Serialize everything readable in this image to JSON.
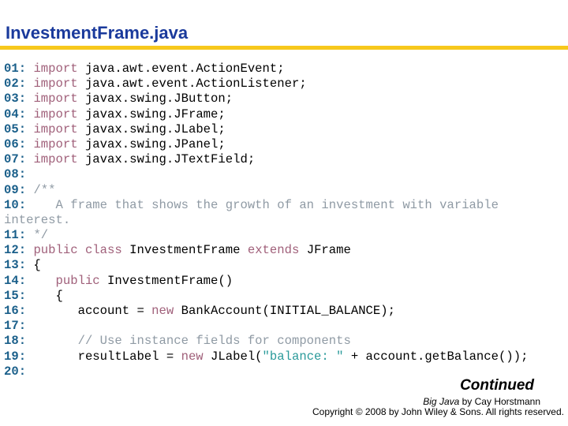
{
  "header": {
    "title": "InvestmentFrame.java",
    "rule_color": "#f7c81c",
    "title_color": "#1a3a9c"
  },
  "code": {
    "colors": {
      "line_number": "#1a5f8a",
      "keyword": "#a0607a",
      "comment": "#8f9aa4",
      "string": "#2a9a9a",
      "text": "#000000"
    },
    "lines": [
      {
        "n": "01:",
        "tokens": [
          {
            "t": " "
          },
          {
            "k": "kw",
            "t": "import"
          },
          {
            "t": " java.awt.event.ActionEvent;"
          }
        ]
      },
      {
        "n": "02:",
        "tokens": [
          {
            "t": " "
          },
          {
            "k": "kw",
            "t": "import"
          },
          {
            "t": " java.awt.event.ActionListener;"
          }
        ]
      },
      {
        "n": "03:",
        "tokens": [
          {
            "t": " "
          },
          {
            "k": "kw",
            "t": "import"
          },
          {
            "t": " javax.swing.JButton;"
          }
        ]
      },
      {
        "n": "04:",
        "tokens": [
          {
            "t": " "
          },
          {
            "k": "kw",
            "t": "import"
          },
          {
            "t": " javax.swing.JFrame;"
          }
        ]
      },
      {
        "n": "05:",
        "tokens": [
          {
            "t": " "
          },
          {
            "k": "kw",
            "t": "import"
          },
          {
            "t": " javax.swing.JLabel;"
          }
        ]
      },
      {
        "n": "06:",
        "tokens": [
          {
            "t": " "
          },
          {
            "k": "kw",
            "t": "import"
          },
          {
            "t": " javax.swing.JPanel;"
          }
        ]
      },
      {
        "n": "07:",
        "tokens": [
          {
            "t": " "
          },
          {
            "k": "kw",
            "t": "import"
          },
          {
            "t": " javax.swing.JTextField;"
          }
        ]
      },
      {
        "n": "08:",
        "tokens": []
      },
      {
        "n": "09:",
        "tokens": [
          {
            "t": " "
          },
          {
            "k": "cm",
            "t": "/**"
          }
        ]
      },
      {
        "n": "10:",
        "tokens": [
          {
            "t": " "
          },
          {
            "k": "cm",
            "t": "   A frame that shows the growth of an investment with variable"
          }
        ]
      },
      {
        "n": "",
        "tokens": [
          {
            "k": "cm",
            "t": "interest."
          }
        ]
      },
      {
        "n": "11:",
        "tokens": [
          {
            "t": " "
          },
          {
            "k": "cm",
            "t": "*/"
          }
        ]
      },
      {
        "n": "12:",
        "tokens": [
          {
            "t": " "
          },
          {
            "k": "kw",
            "t": "public"
          },
          {
            "t": " "
          },
          {
            "k": "kw",
            "t": "class"
          },
          {
            "t": " InvestmentFrame "
          },
          {
            "k": "kw",
            "t": "extends"
          },
          {
            "t": " JFrame"
          }
        ]
      },
      {
        "n": "13:",
        "tokens": [
          {
            "t": " {"
          }
        ]
      },
      {
        "n": "14:",
        "tokens": [
          {
            "t": "    "
          },
          {
            "k": "kw",
            "t": "public"
          },
          {
            "t": " InvestmentFrame()"
          }
        ]
      },
      {
        "n": "15:",
        "tokens": [
          {
            "t": "    {"
          }
        ]
      },
      {
        "n": "16:",
        "tokens": [
          {
            "t": "       account = "
          },
          {
            "k": "kw",
            "t": "new"
          },
          {
            "t": " BankAccount(INITIAL_BALANCE);"
          }
        ]
      },
      {
        "n": "17:",
        "tokens": []
      },
      {
        "n": "18:",
        "tokens": [
          {
            "t": "       "
          },
          {
            "k": "cm",
            "t": "// Use instance fields for components"
          }
        ]
      },
      {
        "n": "19:",
        "tokens": [
          {
            "t": "       resultLabel = "
          },
          {
            "k": "kw",
            "t": "new"
          },
          {
            "t": " JLabel("
          },
          {
            "k": "str",
            "t": "\"balance: \""
          },
          {
            "t": " + account.getBalance());"
          }
        ]
      },
      {
        "n": "20:",
        "tokens": []
      }
    ]
  },
  "footer": {
    "continued": "Continued",
    "book_title": "Big Java",
    "book_author": " by Cay Horstmann",
    "copyright": "Copyright © 2008 by John Wiley & Sons.  All rights reserved."
  }
}
